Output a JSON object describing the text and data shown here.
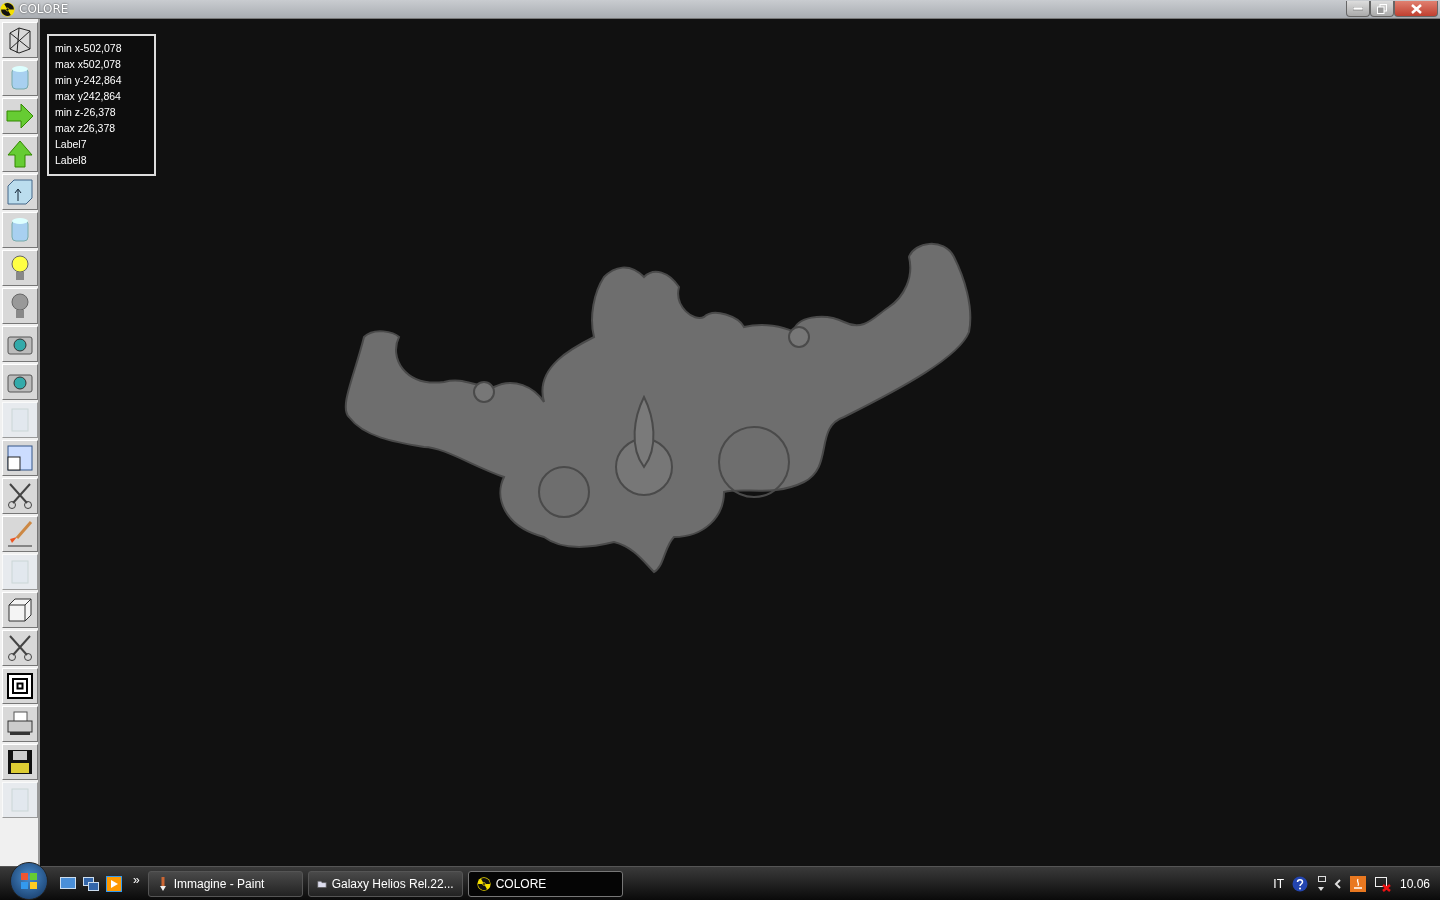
{
  "window": {
    "title": "COLORE"
  },
  "tools": [
    {
      "kind": "wireframe",
      "disabled": false
    },
    {
      "kind": "cylinder",
      "disabled": false
    },
    {
      "kind": "arrow-right",
      "disabled": false
    },
    {
      "kind": "arrow-up",
      "disabled": false
    },
    {
      "kind": "box-arrow",
      "disabled": false
    },
    {
      "kind": "cylinder",
      "disabled": false
    },
    {
      "kind": "bulb-on",
      "disabled": false
    },
    {
      "kind": "bulb-off",
      "disabled": false
    },
    {
      "kind": "camera",
      "disabled": false
    },
    {
      "kind": "camera",
      "disabled": false
    },
    {
      "kind": "blank",
      "disabled": true
    },
    {
      "kind": "window",
      "disabled": false
    },
    {
      "kind": "scissors",
      "disabled": false
    },
    {
      "kind": "brush",
      "disabled": false
    },
    {
      "kind": "blank",
      "disabled": true
    },
    {
      "kind": "cube",
      "disabled": false
    },
    {
      "kind": "scissors",
      "disabled": false
    },
    {
      "kind": "squares",
      "disabled": false
    },
    {
      "kind": "printer",
      "disabled": false
    },
    {
      "kind": "floppy",
      "disabled": false
    },
    {
      "kind": "blank",
      "disabled": true
    }
  ],
  "info_labels": [
    "min x-502,078",
    "max x502,078",
    "min y-242,864",
    "max y242,864",
    "min z-26,378",
    "max z26,378",
    "Label7",
    "Label8"
  ],
  "taskbar": {
    "overflow": "»",
    "tasks": [
      {
        "label": "Immagine - Paint",
        "selected": false,
        "kind": "paint"
      },
      {
        "label": "Galaxy Helios  Rel.22...",
        "selected": false,
        "kind": "folder"
      },
      {
        "label": "COLORE",
        "selected": true,
        "kind": "radiation"
      }
    ],
    "language": "IT",
    "clock": "10.06"
  }
}
